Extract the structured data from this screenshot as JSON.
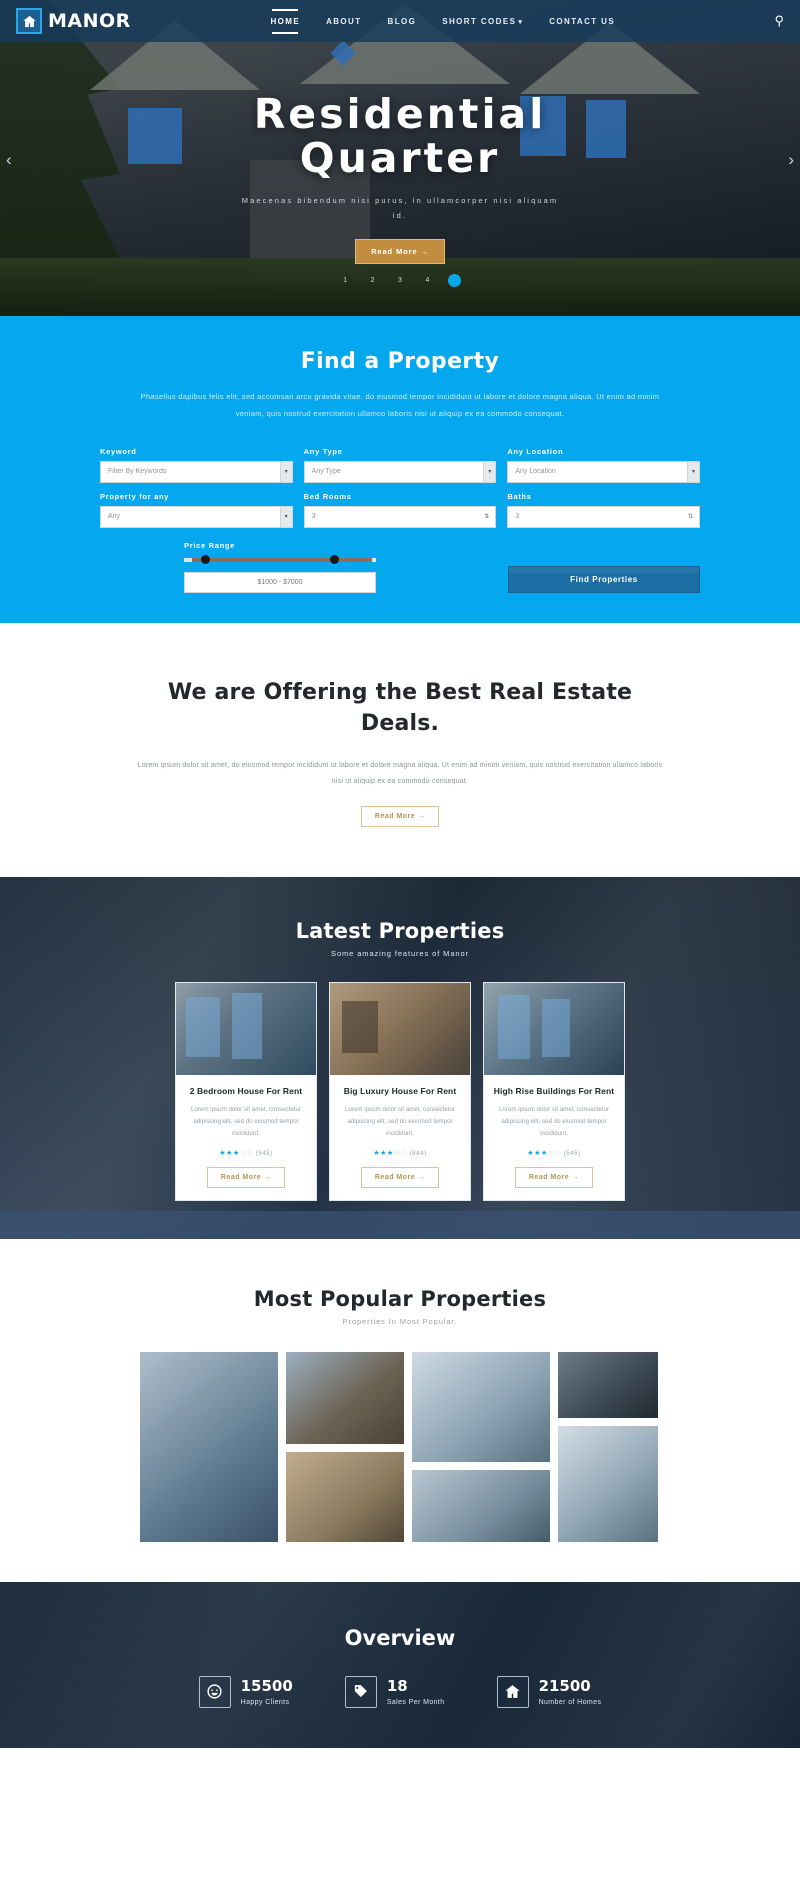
{
  "header": {
    "logo_text": "MANOR",
    "logo_icon": "home-icon",
    "search_icon": "search-icon",
    "nav": [
      {
        "label": "HOME",
        "active": true
      },
      {
        "label": "ABOUT",
        "active": false
      },
      {
        "label": "BLOG",
        "active": false
      },
      {
        "label": "SHORT CODES",
        "active": false,
        "caret": "▾"
      },
      {
        "label": "CONTACT US",
        "active": false
      }
    ]
  },
  "hero": {
    "title_line1": "Residential",
    "title_line2": "Quarter",
    "subtitle": "Maecenas bibendum nisi purus, in ullamcorper nisi aliquam id.",
    "button_label": "Read More →",
    "prev_icon": "chevron-left-icon",
    "next_icon": "chevron-right-icon",
    "dots": [
      "1",
      "2",
      "3",
      "4",
      ""
    ],
    "active_dot_index": 4
  },
  "find": {
    "title": "Find a Property",
    "description": "Phasellus dapibus felis elit, sed accumsan arcu gravida vitae. do eiusmod tempor incididunt ut labore et dolore magna aliqua. Ut enim ad minim veniam, quis nostrud exercitation ullamco laboris nisi ut aliquip ex ea commodo consequat.",
    "fields": [
      {
        "label": "Keyword",
        "value": "Filter By Keywords",
        "type": "select"
      },
      {
        "label": "Any Type",
        "value": "Any Type",
        "type": "select"
      },
      {
        "label": "Any Location",
        "value": "Any Location",
        "type": "select"
      },
      {
        "label": "Property for any",
        "value": "Any",
        "type": "select"
      },
      {
        "label": "Bed Rooms",
        "value": "3",
        "type": "number"
      },
      {
        "label": "Baths",
        "value": "3",
        "type": "number"
      }
    ],
    "price_label": "Price Range",
    "price_value": "$1000 - $7000",
    "submit_label": "Find Properties"
  },
  "offer": {
    "title": "We are Offering the Best Real Estate Deals.",
    "description": "Lorem ipsum dolor sit amet, do eiusmod tempor incididunt ut labore et dolore magna aliqua. Ut enim ad minim veniam, quis nostrud exercitation ullamco laboris nisi ut aliquip ex ea commodo consequat.",
    "button_label": "Read More →"
  },
  "latest": {
    "title": "Latest Properties",
    "subtitle": "Some amazing features of Manor",
    "cards": [
      {
        "title": "2 Bedroom House For Rent",
        "text": "Lorem ipsum dolor sit amet, consectetur adipiscing elit, sed do eiusmod tempor incididunt.",
        "stars": "★★★",
        "stars_empty": "☆☆",
        "rating_count": "(545)",
        "button_label": "Read More →"
      },
      {
        "title": "Big Luxury House For Rent",
        "text": "Lorem ipsum dolor sit amet, consectetur adipiscing elit, sed do eiusmod tempor incididunt.",
        "stars": "★★★",
        "stars_empty": "☆☆",
        "rating_count": "(884)",
        "button_label": "Read More →"
      },
      {
        "title": "High Rise Buildings For Rent",
        "text": "Lorem ipsum dolor sit amet, consectetur adipiscing elit, sed do eiusmod tempor incididunt.",
        "stars": "★★★",
        "stars_empty": "☆☆",
        "rating_count": "(545)",
        "button_label": "Read More →"
      }
    ]
  },
  "popular": {
    "title": "Most Popular Properties",
    "subtitle": "Properties In Most Popular."
  },
  "overview": {
    "title": "Overview",
    "stats": [
      {
        "icon": "smiley-icon",
        "number": "15500",
        "label": "Happy Clients"
      },
      {
        "icon": "tag-icon",
        "number": "18",
        "label": "Sales Per Month"
      },
      {
        "icon": "home-icon",
        "number": "21500",
        "label": "Number of Homes"
      }
    ]
  },
  "colors": {
    "accent_blue": "#05a8ef",
    "nav_bar": "#163a5c",
    "gold": "#c28d3e",
    "button_blue": "#1c6ea4"
  }
}
